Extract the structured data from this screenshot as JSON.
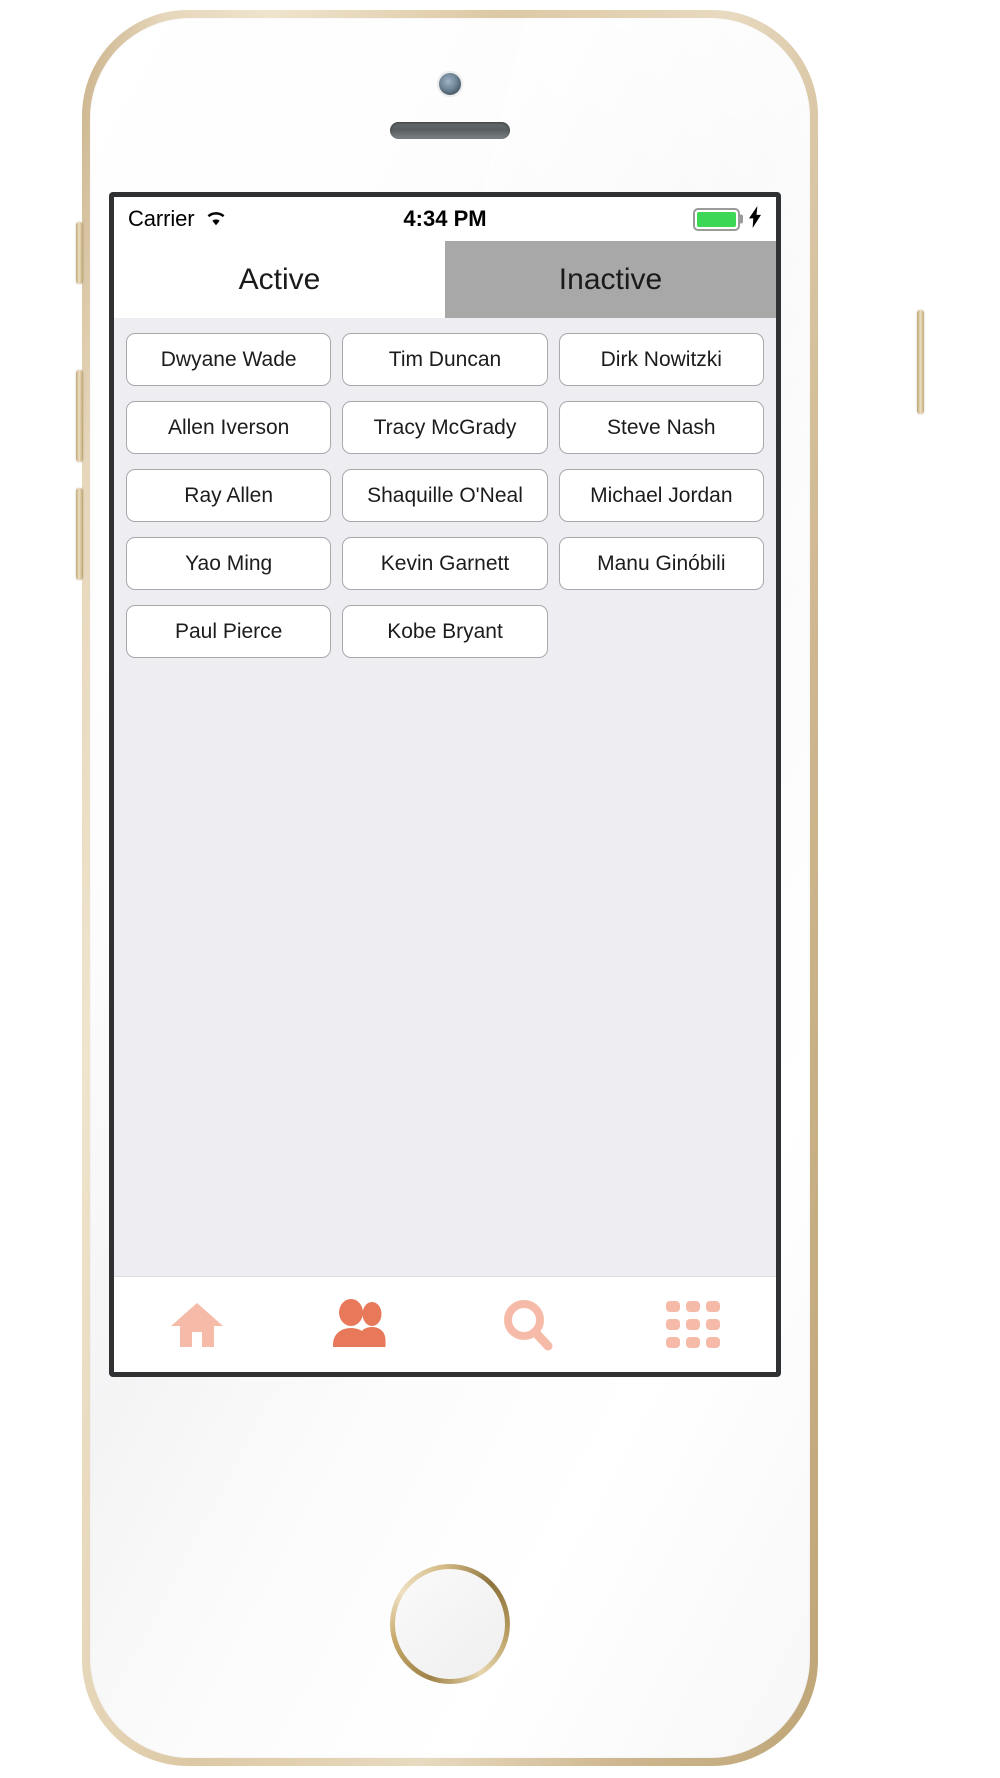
{
  "device": {
    "name": "iPhone (gold/white)",
    "frame_color": "#dcc8a4",
    "body_color": "#ffffff"
  },
  "status_bar": {
    "carrier": "Carrier",
    "wifi_icon": "wifi-icon",
    "time": "4:34 PM",
    "battery_icon": "battery-icon",
    "battery_level_percent": 100,
    "battery_color": "#3bd755",
    "charging_icon": "lightning-bolt-icon",
    "charging": true
  },
  "segmented_control": {
    "tabs": [
      {
        "label": "Active",
        "selected": false
      },
      {
        "label": "Inactive",
        "selected": true
      }
    ],
    "selected_background": "#a8a8a8",
    "unselected_background": "#ffffff"
  },
  "content": {
    "background_color": "#eeedf2",
    "columns": 3,
    "players": [
      "Dwyane Wade",
      "Tim Duncan",
      "Dirk Nowitzki",
      "Allen Iverson",
      "Tracy McGrady",
      "Steve Nash",
      "Ray Allen",
      "Shaquille O'Neal",
      "Michael Jordan",
      "Yao Ming",
      "Kevin Garnett",
      "Manu Ginóbili",
      "Paul Pierce",
      "Kobe Bryant"
    ]
  },
  "tabbar": {
    "active_color": "#e8785a",
    "inactive_color": "#f5bba8",
    "items": [
      {
        "icon": "home-icon",
        "name": "tabbar-home",
        "active": false
      },
      {
        "icon": "people-icon",
        "name": "tabbar-people",
        "active": true
      },
      {
        "icon": "search-icon",
        "name": "tabbar-search",
        "active": false
      },
      {
        "icon": "grid-icon",
        "name": "tabbar-more",
        "active": false
      }
    ]
  }
}
